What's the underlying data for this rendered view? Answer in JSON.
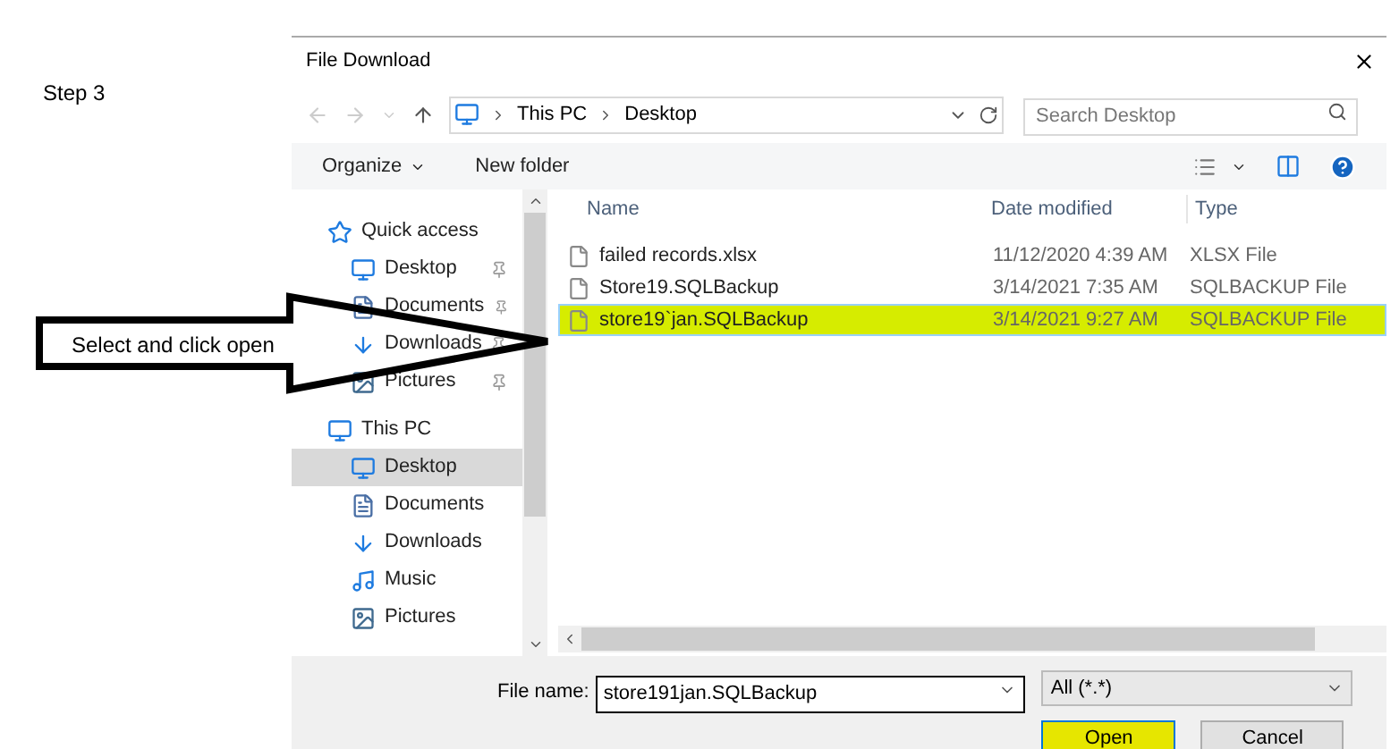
{
  "step_label": "Step 3",
  "callout": {
    "text": "Select  and click open"
  },
  "window": {
    "title": "File Download"
  },
  "address_bar": {
    "path": [
      "This PC",
      "Desktop"
    ]
  },
  "search": {
    "placeholder": "Search Desktop"
  },
  "toolbar": {
    "organize": "Organize",
    "new_folder": "New folder"
  },
  "nav_pane": {
    "groups": [
      {
        "label": "Quick access",
        "kind": "star",
        "selected": false,
        "children": [
          {
            "label": "Desktop",
            "kind": "desktop",
            "pinned": true,
            "selected": false
          },
          {
            "label": "Documents",
            "kind": "documents",
            "pinned": true,
            "selected": false
          },
          {
            "label": "Downloads",
            "kind": "downloads",
            "pinned": true,
            "selected": false
          },
          {
            "label": "Pictures",
            "kind": "pictures",
            "pinned": true,
            "selected": false
          }
        ]
      },
      {
        "label": "This PC",
        "kind": "pc",
        "selected": false,
        "children": [
          {
            "label": "Desktop",
            "kind": "desktop",
            "pinned": false,
            "selected": true
          },
          {
            "label": "Documents",
            "kind": "documents",
            "pinned": false,
            "selected": false
          },
          {
            "label": "Downloads",
            "kind": "downloads",
            "pinned": false,
            "selected": false
          },
          {
            "label": "Music",
            "kind": "music",
            "pinned": false,
            "selected": false
          },
          {
            "label": "Pictures",
            "kind": "pictures",
            "pinned": false,
            "selected": false
          }
        ]
      }
    ]
  },
  "table": {
    "columns": [
      "Name",
      "Date modified",
      "Type"
    ],
    "rows": [
      {
        "name": "failed records.xlsx",
        "date": "11/12/2020 4:39 AM",
        "type": "XLSX File",
        "selected": false,
        "highlighted": false
      },
      {
        "name": "Store19.SQLBackup",
        "date": "3/14/2021 7:35 AM",
        "type": "SQLBACKUP File",
        "selected": false,
        "highlighted": false
      },
      {
        "name": "store19`jan.SQLBackup",
        "date": "3/14/2021 9:27 AM",
        "type": "SQLBACKUP File",
        "selected": true,
        "highlighted": true
      }
    ]
  },
  "footer": {
    "file_name_label": "File name:",
    "file_name": "store191jan.SQLBackup",
    "filter": "All (*.*)",
    "open": "Open",
    "open_highlighted": true,
    "cancel": "Cancel"
  }
}
